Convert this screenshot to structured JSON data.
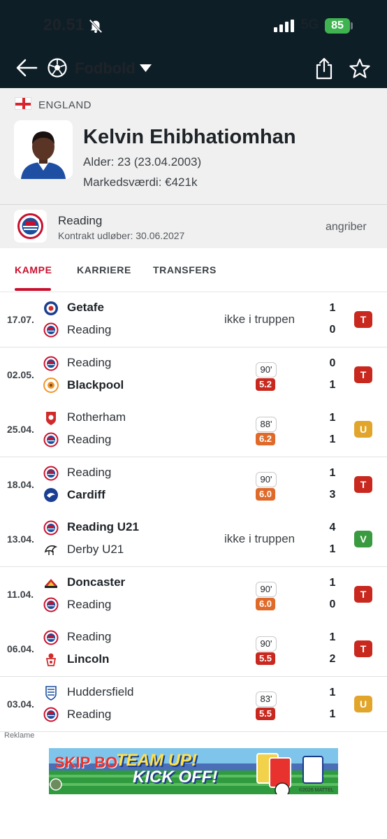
{
  "status_bar": {
    "time": "20.51",
    "network": "5G",
    "battery": "85"
  },
  "header": {
    "sport": "Fodbold"
  },
  "player": {
    "country": "ENGLAND",
    "name": "Kelvin Ehibhatiomhan",
    "age_line": "Alder: 23 (23.04.2003)",
    "value_line": "Markedsværdi: €421k"
  },
  "club": {
    "name": "Reading",
    "contract": "Kontrakt udløber: 30.06.2027",
    "position": "angriber"
  },
  "tabs": [
    "KAMPE",
    "KARRIERE",
    "TRANSFERS"
  ],
  "matches": [
    {
      "date": "17.07.",
      "home": "Getafe",
      "away": "Reading",
      "home_bold": true,
      "away_bold": false,
      "note": "ikke i truppen",
      "minutes": "",
      "rating": "",
      "home_score": "1",
      "away_score": "0",
      "result": "T"
    },
    {
      "date": "02.05.",
      "home": "Reading",
      "away": "Blackpool",
      "home_bold": false,
      "away_bold": true,
      "note": "",
      "minutes": "90'",
      "rating": "5.2",
      "home_score": "0",
      "away_score": "1",
      "result": "T"
    },
    {
      "date": "25.04.",
      "home": "Rotherham",
      "away": "Reading",
      "home_bold": false,
      "away_bold": false,
      "note": "",
      "minutes": "88'",
      "rating": "6.2",
      "home_score": "1",
      "away_score": "1",
      "result": "U"
    },
    {
      "date": "18.04.",
      "home": "Reading",
      "away": "Cardiff",
      "home_bold": false,
      "away_bold": true,
      "note": "",
      "minutes": "90'",
      "rating": "6.0",
      "home_score": "1",
      "away_score": "3",
      "result": "T"
    },
    {
      "date": "13.04.",
      "home": "Reading U21",
      "away": "Derby U21",
      "home_bold": true,
      "away_bold": false,
      "note": "ikke i truppen",
      "minutes": "",
      "rating": "",
      "home_score": "4",
      "away_score": "1",
      "result": "V"
    },
    {
      "date": "11.04.",
      "home": "Doncaster",
      "away": "Reading",
      "home_bold": true,
      "away_bold": false,
      "note": "",
      "minutes": "90'",
      "rating": "6.0",
      "home_score": "1",
      "away_score": "0",
      "result": "T"
    },
    {
      "date": "06.04.",
      "home": "Reading",
      "away": "Lincoln",
      "home_bold": false,
      "away_bold": true,
      "note": "",
      "minutes": "90'",
      "rating": "5.5",
      "home_score": "1",
      "away_score": "2",
      "result": "T"
    },
    {
      "date": "03.04.",
      "home": "Huddersfield",
      "away": "Reading",
      "home_bold": false,
      "away_bold": false,
      "note": "",
      "minutes": "83'",
      "rating": "5.5",
      "home_score": "1",
      "away_score": "1",
      "result": "U"
    }
  ],
  "ad": {
    "label": "Reklame",
    "brand": "SKIP BO",
    "headline": "TEAM UP!",
    "subline": "KICK OFF!",
    "copyright": "©2026 MATTEL"
  },
  "colors": {
    "header_bg": "#0e1e27",
    "accent": "#c8102e",
    "result_loss": "#c8281e",
    "result_draw": "#e2a52c",
    "result_win": "#3a9a3f",
    "rating_red": "#c8281e",
    "rating_orange": "#e06a2a"
  },
  "icons": {
    "back": "arrow-left-icon",
    "sport": "football-icon",
    "dropdown": "caret-down-icon",
    "share": "share-icon",
    "favorite": "star-icon",
    "mute": "bell-off-icon",
    "signal": "signal-icon"
  }
}
